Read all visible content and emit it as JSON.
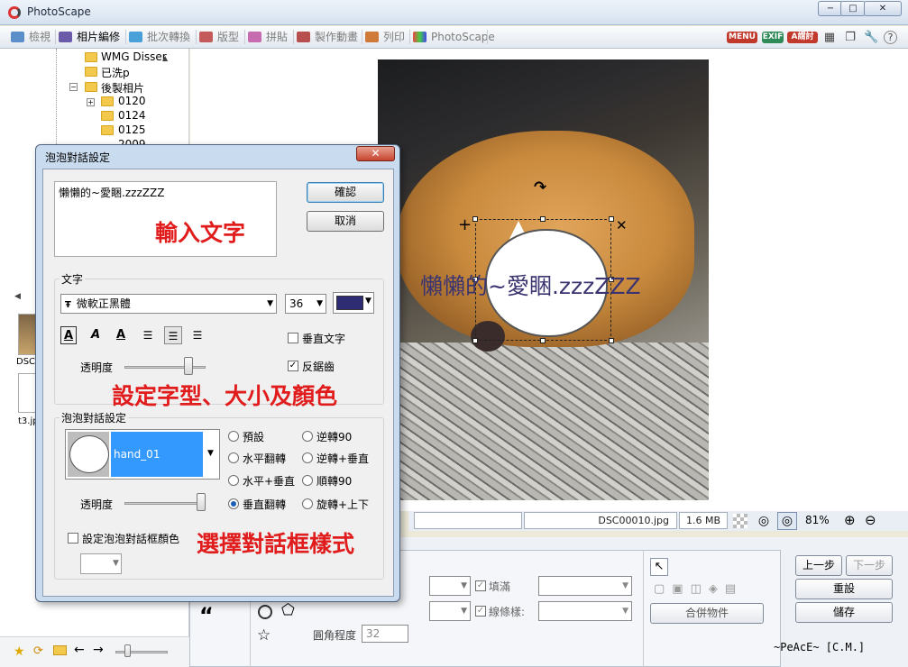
{
  "app": {
    "title": "PhotoScape"
  },
  "window_controls": {
    "minimize": "−",
    "maximize": "□",
    "close": "✕"
  },
  "tabs": [
    {
      "label": "檢視",
      "active": false
    },
    {
      "label": "相片編修",
      "active": true
    },
    {
      "label": "批次轉換",
      "active": false
    },
    {
      "label": "版型",
      "active": false
    },
    {
      "label": "拼貼",
      "active": false
    },
    {
      "label": "製作動畫",
      "active": false
    },
    {
      "label": "列印",
      "active": false
    },
    {
      "label": "PhotoScape",
      "active": false
    }
  ],
  "toolbar_badges": {
    "menu": "MENU",
    "exif": "EXIF",
    "aa": "A謂討"
  },
  "folder_tree": [
    "WMG Disser",
    "已洗p",
    "後製相片",
    "0120",
    "0124",
    "0125",
    "2009"
  ],
  "thumbnails": [
    "DSC",
    "t3.jp"
  ],
  "overlay_text": "懶懶的~愛睏.zzzZZZ",
  "status": {
    "filename": "DSC00010.jpg",
    "size": "1.6 MB",
    "zoom": "81%"
  },
  "bottom": {
    "prev": "上一步",
    "next": "下一步",
    "reset": "重設",
    "save": "儲存",
    "merge": "合併物件",
    "fill": "填滿",
    "outline": "線條樣:",
    "corner": "圓角程度",
    "corner_value": "32",
    "quote_mark": "“",
    "signature": "~PeAcE~ [C.M.]"
  },
  "dialog": {
    "title": "泡泡對話設定",
    "close": "✕",
    "input_text": "懶懶的~愛睏.zzzZZZ",
    "ok": "確認",
    "cancel": "取消",
    "text_group": "文字",
    "font": "微軟正黑體",
    "font_size": "36",
    "font_color": "#2e2d74",
    "vertical_text": "垂直文字",
    "antialias": "反鋸齒",
    "antialias_checked": true,
    "opacity_label": "透明度",
    "text_opacity": 0.82,
    "bubble_group": "泡泡對話設定",
    "bubble_style": "hand_01",
    "bubble_opacity_label": "透明度",
    "bubble_opacity": 1.0,
    "options": [
      {
        "label": "預設",
        "checked": false
      },
      {
        "label": "逆轉90",
        "checked": false
      },
      {
        "label": "水平翻轉",
        "checked": false
      },
      {
        "label": "逆轉+垂直",
        "checked": false
      },
      {
        "label": "水平+垂直",
        "checked": false
      },
      {
        "label": "順轉90",
        "checked": false
      },
      {
        "label": "垂直翻轉",
        "checked": true
      },
      {
        "label": "旋轉+上下",
        "checked": false
      }
    ],
    "bubble_color_label": "設定泡泡對話框顏色",
    "font_icon": "Ŧ"
  },
  "annotations": {
    "input": "輸入文字",
    "font": "設定字型、大小及顏色",
    "style": "選擇對話框樣式"
  }
}
